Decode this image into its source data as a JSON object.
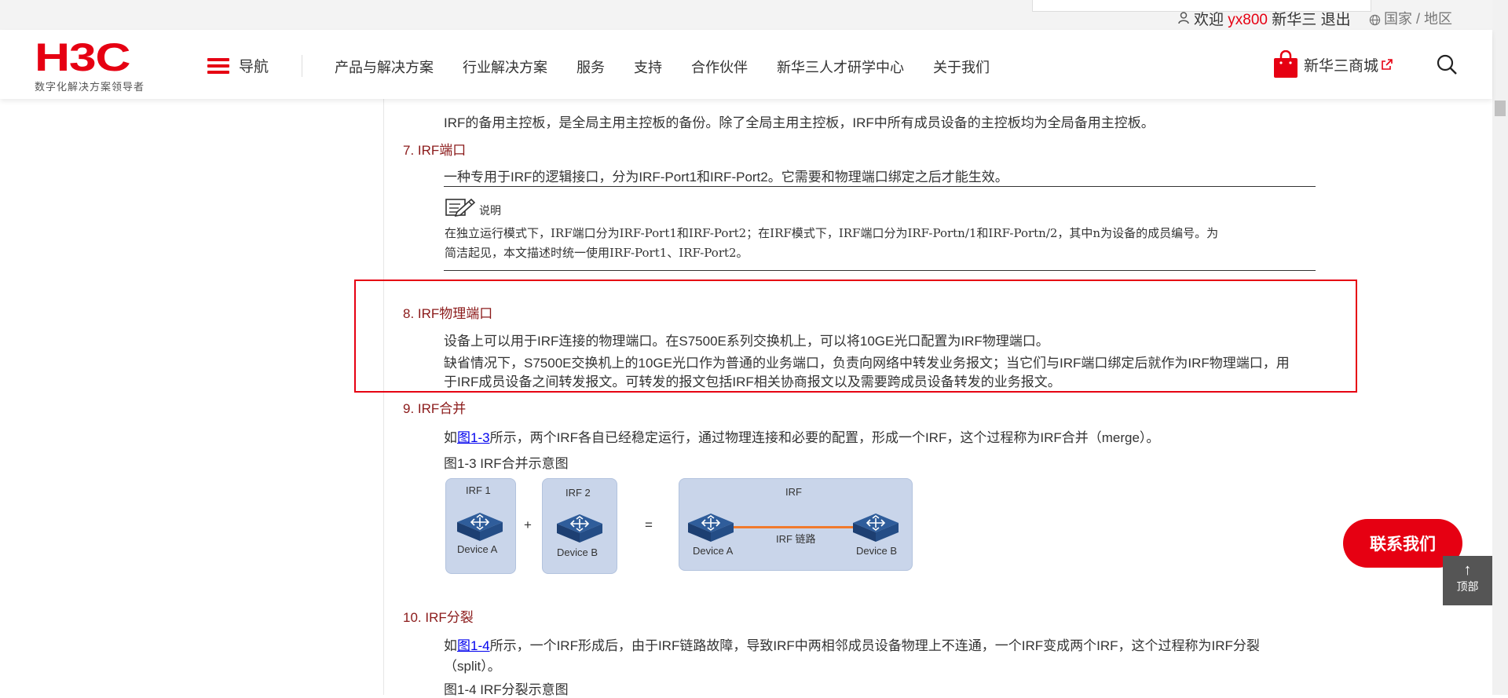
{
  "topbar": {
    "welcome": "欢迎",
    "username": "yx800",
    "company": "新华三",
    "logout": "退出",
    "region": "国家 / 地区"
  },
  "header": {
    "logo_text": "H3C",
    "logo_tagline": "数字化解决方案领导者",
    "nav_label": "导航",
    "nav_links": [
      "产品与解决方案",
      "行业解决方案",
      "服务",
      "支持",
      "合作伙伴",
      "新华三人才研学中心",
      "关于我们"
    ],
    "mall_label": "新华三商城",
    "icons": {
      "menu": "hamburger-icon",
      "bag": "shopping-bag-icon",
      "external": "external-link-icon",
      "search": "search-icon",
      "user": "user-icon",
      "globe": "globe-icon"
    },
    "accent_color": "#e60012"
  },
  "article": {
    "p_backup": "IRF的备用主控板，是全局主用主控板的备份。除了全局主用主控板，IRF中所有成员设备的主控板均为全局备用主控板。",
    "h7": "7. IRF端口",
    "p7": "一种专用于IRF的逻辑接口，分为IRF-Port1和IRF-Port2。它需要和物理端口绑定之后才能生效。",
    "note_label": "说明",
    "note_line1": "在独立运行模式下，IRF端口分为IRF-Port1和IRF-Port2；在IRF模式下，IRF端口分为IRF-Portn/1和IRF-Portn/2，其中n为设备的成员编号。为",
    "note_line2": "简洁起见，本文描述时统一使用IRF-Port1、IRF-Port2。",
    "h8": "8. IRF物理端口",
    "p8a": "设备上可以用于IRF连接的物理端口。在S7500E系列交换机上，可以将10GE光口配置为IRF物理端口。",
    "p8b": "缺省情况下，S7500E交换机上的10GE光口作为普通的业务端口，负责向网络中转发业务报文；当它们与IRF端口绑定后就作为IRF物理端口，用",
    "p8c": "于IRF成员设备之间转发报文。可转发的报文包括IRF相关协商报文以及需要跨成员设备转发的业务报文。",
    "h9": "9. IRF合并",
    "p9_pre": "如",
    "p9_link": "图1-3",
    "p9_post": "所示，两个IRF各自已经稳定运行，通过物理连接和必要的配置，形成一个IRF，这个过程称为IRF合并（merge）。",
    "fig3_caption": "图1-3 IRF合并示意图",
    "h10": "10. IRF分裂",
    "p10_pre": "如",
    "p10_link": "图1-4",
    "p10_post": "所示，一个IRF形成后，由于IRF链路故障，导致IRF中两相邻成员设备物理上不连通，一个IRF变成两个IRF，这个过程称为IRF分裂",
    "p10_line2": "（split）。",
    "fig4_caption": "图1-4 IRF分裂示意图"
  },
  "figure": {
    "irf1": "IRF 1",
    "irf2": "IRF 2",
    "irf": "IRF",
    "plus": "+",
    "equals": "=",
    "device_a": "Device A",
    "device_b": "Device B",
    "link_label": "IRF 链路"
  },
  "floating": {
    "contact": "联系我们",
    "top": "顶部"
  }
}
